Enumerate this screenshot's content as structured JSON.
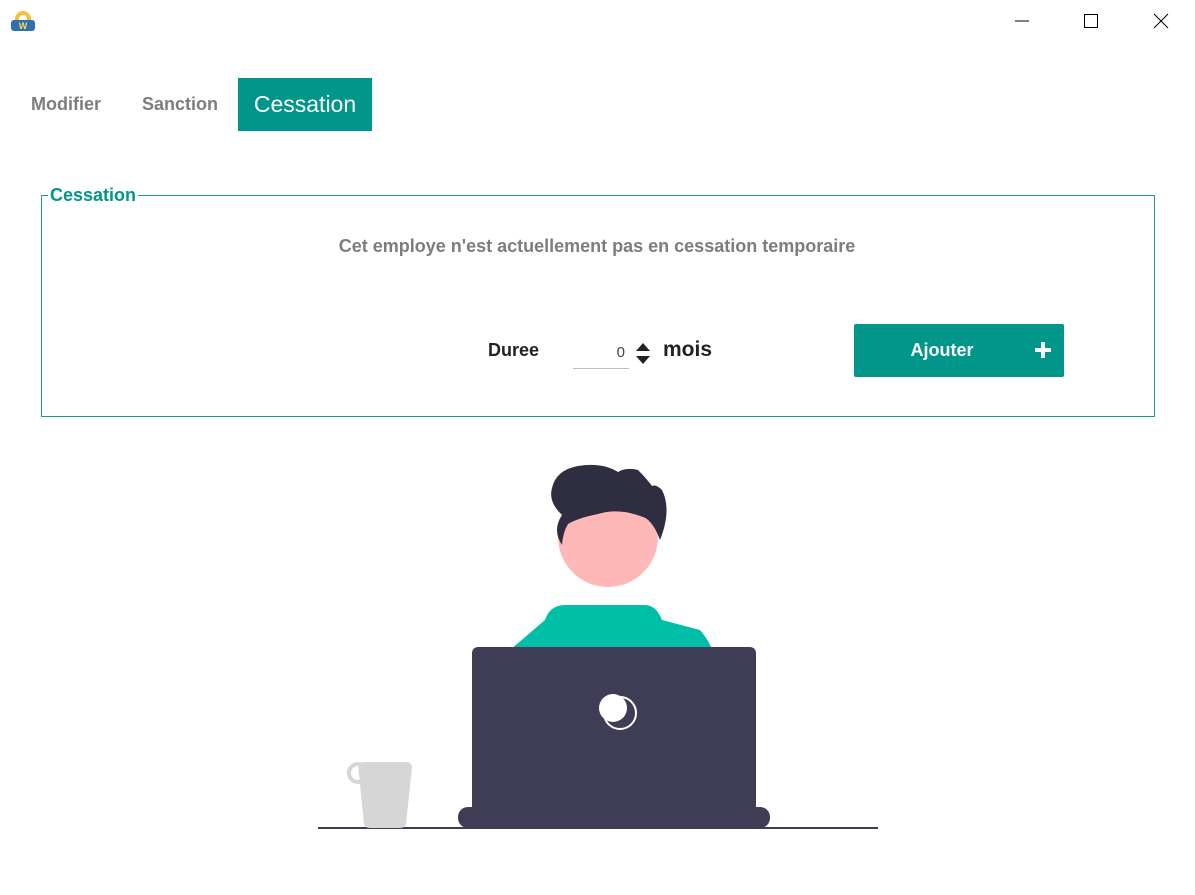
{
  "window": {
    "app_icon": "windev-app-icon",
    "controls": [
      "minimize-icon",
      "maximize-icon",
      "close-icon"
    ]
  },
  "tabs": [
    {
      "label": "Modifier",
      "active": false
    },
    {
      "label": "Sanction",
      "active": false
    },
    {
      "label": "Cessation",
      "active": true
    }
  ],
  "cessation": {
    "group_title": "Cessation",
    "message": "Cet employe n'est actuellement pas en cessation temporaire",
    "duree_label": "Duree",
    "duree_value": "0",
    "unit_label": "mois",
    "add_button_label": "Ajouter",
    "add_button_icon": "plus-icon"
  },
  "colors": {
    "accent": "#00968a",
    "shirt": "#00bfa6",
    "laptop": "#3f3d56",
    "hair": "#2f2e41",
    "skin": "#ffb8b8",
    "cup": "#d6d6d6"
  }
}
